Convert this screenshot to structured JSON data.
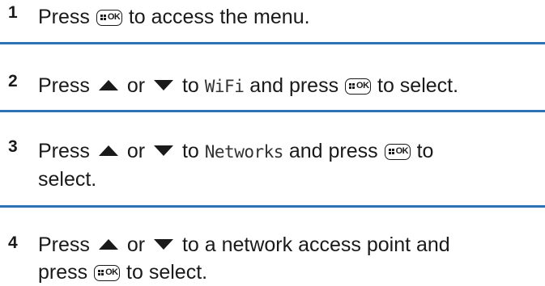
{
  "colors": {
    "separator": "#2f73b7",
    "text": "#1a1a1a"
  },
  "icons": {
    "ok_key": "menu-ok-key-icon",
    "up": "up-arrow-icon",
    "down": "down-arrow-icon"
  },
  "key_label": "OK",
  "steps": [
    {
      "number": "1",
      "t1": "Press",
      "t2": "to access the menu."
    },
    {
      "number": "2",
      "t1": "Press",
      "t2": "or",
      "t3": "to",
      "menu_item": "WiFi",
      "t4": "and press",
      "t5": "to select."
    },
    {
      "number": "3",
      "t1": "Press",
      "t2": "or",
      "t3": "to",
      "menu_item": "Networks",
      "t4": "and press",
      "t5": "to",
      "t6": "select."
    },
    {
      "number": "4",
      "t1": "Press",
      "t2": "or",
      "t3": "to a network access point and",
      "t4": "press",
      "t5": "to select."
    }
  ]
}
